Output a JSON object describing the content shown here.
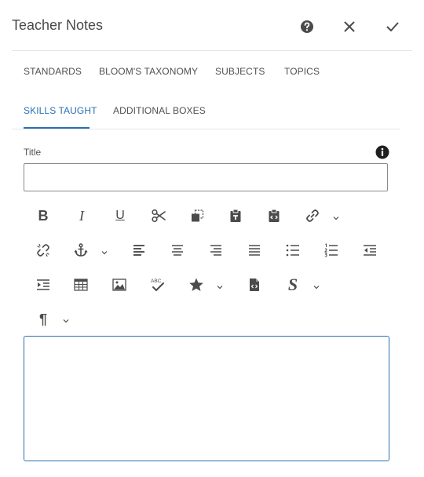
{
  "dialog": {
    "title": "Teacher Notes"
  },
  "header_icons": [
    "help-icon",
    "close-icon",
    "checkmark-icon"
  ],
  "tabs_row1": [
    {
      "label": "STANDARDS"
    },
    {
      "label": "BLOOM'S TAXONOMY"
    },
    {
      "label": "SUBJECTS"
    },
    {
      "label": "TOPICS"
    }
  ],
  "tabs_row2": [
    {
      "label": "SKILLS TAUGHT",
      "active": true
    },
    {
      "label": "ADDITIONAL BOXES",
      "active": false
    }
  ],
  "form": {
    "title_label": "Title",
    "title_value": "",
    "body_value": ""
  },
  "toolbar": {
    "bold_glyph": "B",
    "italic_glyph": "I",
    "underline_glyph": "U",
    "paragraph_glyph": "¶",
    "style_glyph": "S",
    "abc_glyph": "ABC",
    "tools": [
      "bold",
      "italic",
      "underline",
      "cut",
      "copy",
      "paste",
      "paste-as-text",
      "paste-from-word",
      "link",
      "unlink",
      "anchor",
      "align-left",
      "align-center",
      "align-right",
      "justify",
      "bulleted-list",
      "numbered-list",
      "outdent",
      "indent",
      "table",
      "image",
      "spellcheck",
      "special-characters",
      "source-edit",
      "styles",
      "paragraph-format"
    ]
  },
  "colors": {
    "accent": "#2b6fb3",
    "text": "#4b4b4b",
    "border": "#8a8a8a",
    "divider": "#e6e6e6"
  }
}
